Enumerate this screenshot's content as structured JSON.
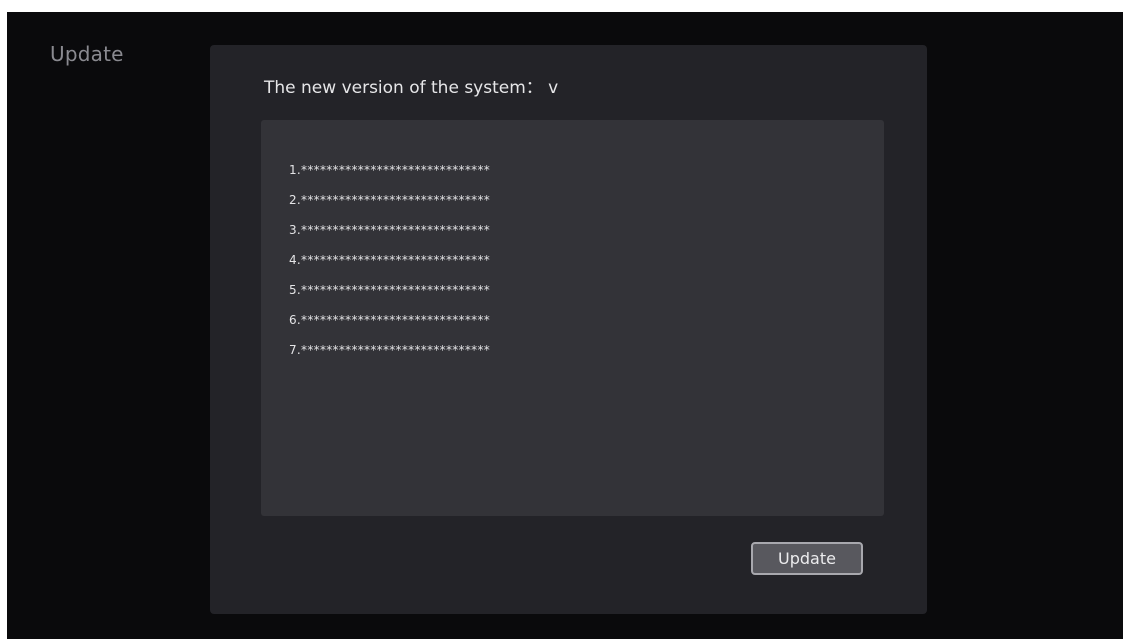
{
  "page": {
    "heading": "Update"
  },
  "dialog": {
    "version_text": "The new version of the system：  v",
    "notes": [
      "1.******************************",
      "2.******************************",
      "3.******************************",
      "4.******************************",
      "5.******************************",
      "6.******************************",
      "7.******************************"
    ],
    "update_button_label": "Update"
  },
  "colors": {
    "screen_background": "#0a0a0c",
    "dialog_background": "#232328",
    "notes_panel_background": "#333338",
    "button_background": "#58585e",
    "button_border": "#a8a8ae"
  }
}
